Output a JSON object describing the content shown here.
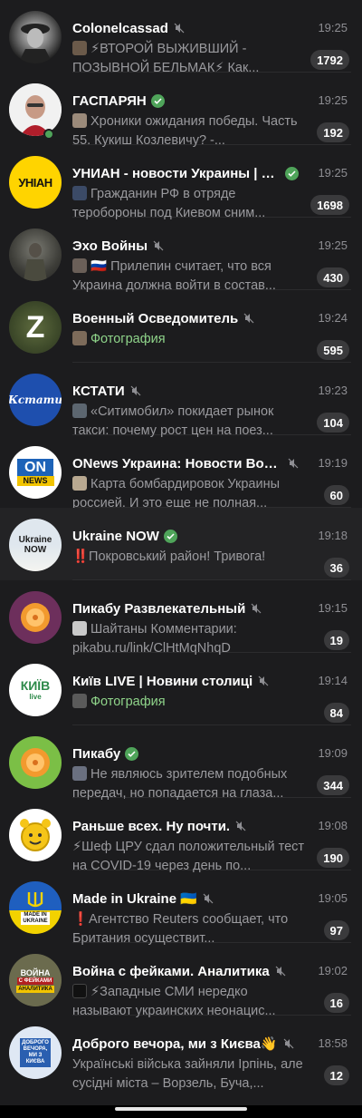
{
  "colors": {
    "background": "#1c1c1e",
    "badge": "#3a3a3c",
    "verified": "#4fa45a",
    "photo_text": "#8fd48a",
    "secondary": "#8e8e93"
  },
  "chats": [
    {
      "title": "Colonelcassad",
      "time": "19:25",
      "badge": "1792",
      "preview": "⚡ВТОРОЙ ВЫЖИВШИЙ - ПОЗЫВНОЙ БЕЛЬМАК⚡  Как..."
    },
    {
      "title": "ГАСПАРЯН",
      "time": "19:25",
      "badge": "192",
      "preview": "Хроники ожидания победы. Часть 55. Кукиш Козлевичу? -..."
    },
    {
      "title": "УНИАН - новости Украины | в...",
      "time": "19:25",
      "badge": "1698",
      "preview": "Гражданин РФ в отряде теробороны под Киевом сним..."
    },
    {
      "title": "Эхо Войны",
      "time": "19:25",
      "badge": "430",
      "preview": "🇷🇺 Прилепин считает, что вся Украина должна войти в состав..."
    },
    {
      "title": "Военный Осведомитель",
      "time": "19:24",
      "badge": "595",
      "preview": "Фотография"
    },
    {
      "title": "КСТАТИ",
      "time": "19:23",
      "badge": "104",
      "preview": "«Ситимобил» покидает рынок такси: почему рост цен на поез..."
    },
    {
      "title": "ONews Украина: Новости Вой...",
      "time": "19:19",
      "badge": "60",
      "preview": "Карта бомбардировок Украины россией. И это еще не полная..."
    },
    {
      "title": "Ukraine NOW",
      "time": "19:18",
      "badge": "36",
      "preview": "‼️Покровський район! Тривога!"
    },
    {
      "title": "Пикабу Развлекательный",
      "time": "19:15",
      "badge": "19",
      "preview": "Шайтаны  Комментарии: pikabu.ru/link/ClHtMqNhqD"
    },
    {
      "title": "Київ LIVE | Новини столиці",
      "time": "19:14",
      "badge": "84",
      "preview": "Фотография"
    },
    {
      "title": "Пикабу",
      "time": "19:09",
      "badge": "344",
      "preview": "Не являюсь зрителем подобных передач, но попадается на глаза..."
    },
    {
      "title": "Раньше всех. Ну почти.",
      "time": "19:08",
      "badge": "190",
      "preview": "⚡Шеф ЦРУ сдал положительный тест на COVID-19 через день по..."
    },
    {
      "title": "Made in Ukraine 🇺🇦",
      "time": "19:05",
      "badge": "97",
      "preview": "❗Агентство Reuters сообщает, что Британия осуществит..."
    },
    {
      "title": "Война с фейками. Аналитика",
      "time": "19:02",
      "badge": "16",
      "preview": "⚡Западные СМИ нередко называют украинских неонацис..."
    },
    {
      "title": "Доброго вечора, ми з Києва👋",
      "time": "18:58",
      "badge": "12",
      "preview": "Українські війська зайняли Ірпінь, але сусідні міста – Ворзель, Буча,..."
    }
  ],
  "avatars": {
    "unian": "УНІАН",
    "z": "Z",
    "kstati": "Кстати",
    "onews_top": "ON",
    "onews_bottom": "NEWS",
    "ukraine_now": "Ukraine NOW",
    "kyiv_live_top": "КИЇВ",
    "kyiv_live_bottom": "live",
    "made_in_ukraine": "MADE IN UKRAINE",
    "voyna_top": "ВОЙНА",
    "voyna_mid": "С ФЕЙКАМИ",
    "voyna_bottom": "АНАЛИТИКА",
    "dobrogo": "ДОБРОГО ВЕЧОРА, МИ З КИЄВА"
  }
}
